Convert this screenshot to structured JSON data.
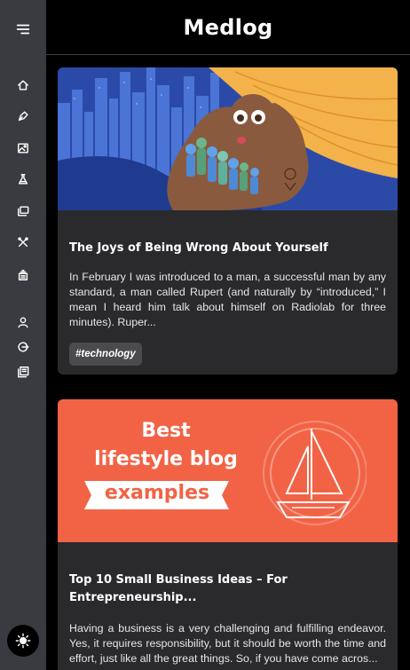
{
  "app": {
    "title": "Medlog"
  },
  "sidebar": {
    "items": [
      {
        "name": "home",
        "icon": "home-icon"
      },
      {
        "name": "write",
        "icon": "pen-nib-icon"
      },
      {
        "name": "gallery",
        "icon": "image-icon"
      },
      {
        "name": "science",
        "icon": "flask-icon"
      },
      {
        "name": "photos",
        "icon": "photos-icon"
      },
      {
        "name": "tools",
        "icon": "tools-icon"
      },
      {
        "name": "posts",
        "icon": "stack-icon"
      },
      {
        "name": "profile",
        "icon": "user-icon"
      },
      {
        "name": "logout",
        "icon": "logout-icon"
      },
      {
        "name": "library",
        "icon": "library-icon"
      }
    ],
    "theme_toggle_icon": "sun-icon"
  },
  "posts": [
    {
      "title": "The Joys of Being Wrong About Yourself",
      "excerpt": "In February I was introduced to a man, a successful man by any standard, a man called Rupert (and naturally by “introduced,” I mean I heard him talk about himself on Radiolab for three minutes). Ruper...",
      "tag": "#technology"
    },
    {
      "title": "Top 10 Small Business Ideas – For Entrepreneurship...",
      "excerpt": "Having a business is a very challenging and fulfilling endeavor. Yes, it requires responsibility, but it should be worth the time and effort, just like all the great things. So, if you have come acros...",
      "image_text": {
        "line1": "Best",
        "line2": "lifestyle blog",
        "line3": "examples"
      }
    }
  ],
  "colors": {
    "sidebar": "#3a3b40",
    "card": "#2a2a2d",
    "banner": "#f26346",
    "accent_blue": "#2d4fb0"
  }
}
